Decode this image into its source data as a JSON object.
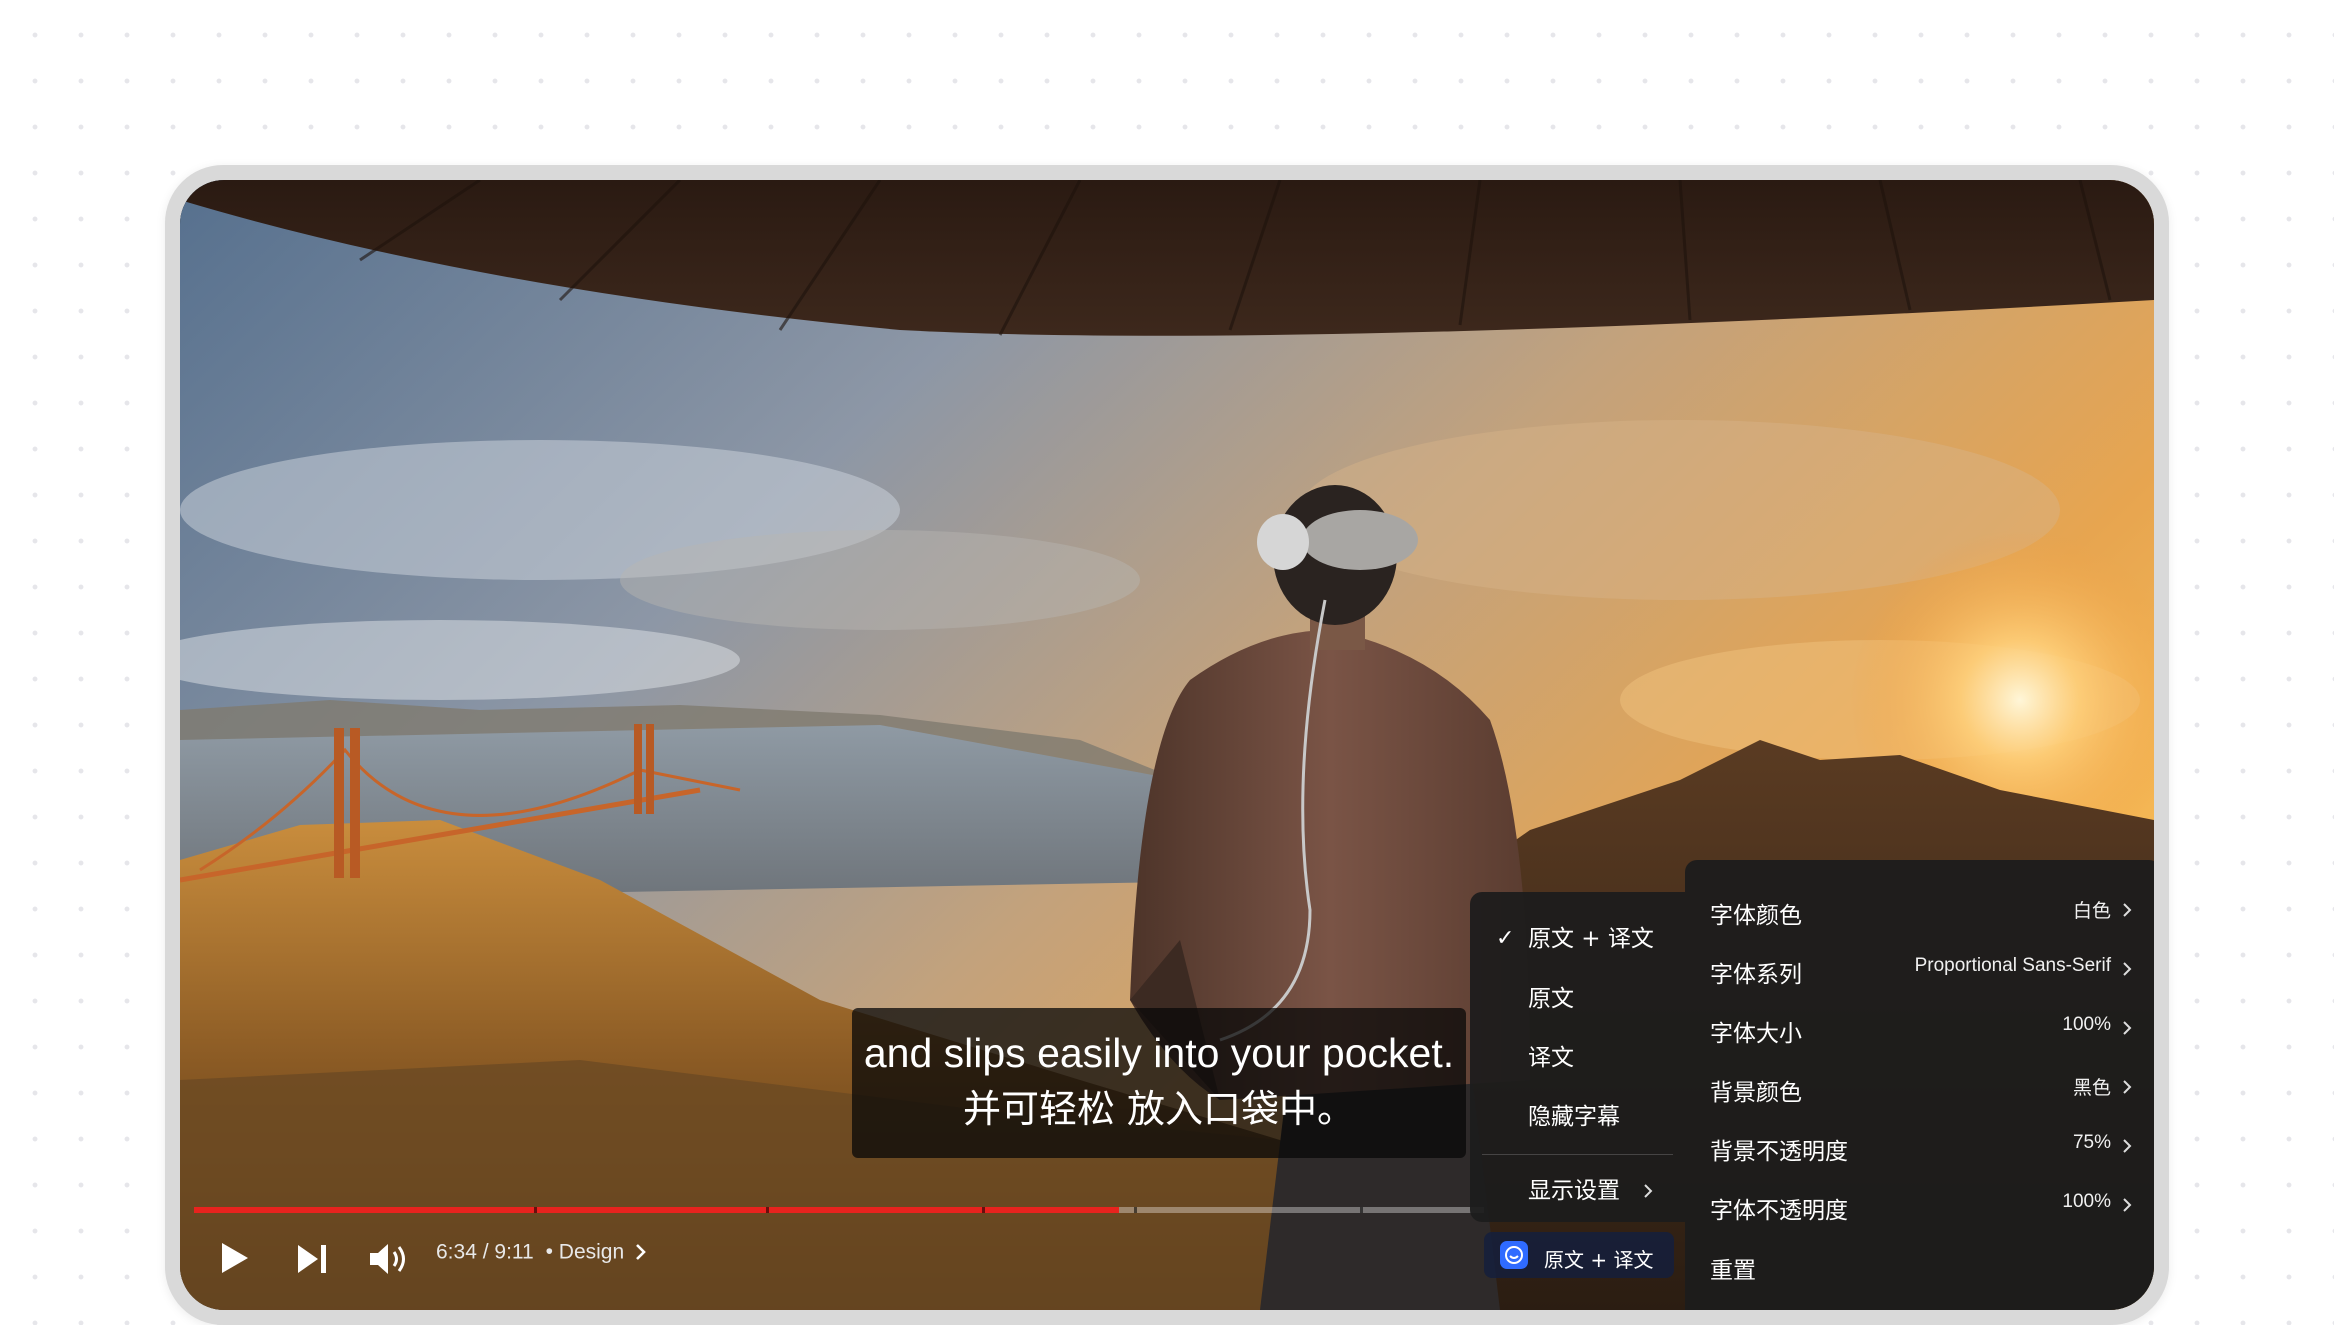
{
  "player": {
    "subtitle": {
      "original": "and slips easily into your pocket.",
      "translation": "并可轻松 放入口袋中。"
    },
    "progress": {
      "fraction": 0.717
    },
    "time": {
      "current": "6:34",
      "separator": "/",
      "duration": "9:11"
    },
    "chapter": {
      "bullet": "•",
      "label": "Design"
    },
    "controls": {
      "play_icon": "play-icon",
      "next_icon": "skip-next-icon",
      "volume_icon": "volume-icon"
    }
  },
  "caption_menu": {
    "items": [
      {
        "label": "原文 + 译文",
        "checked": true
      },
      {
        "label": "原文",
        "checked": false
      },
      {
        "label": "译文",
        "checked": false
      },
      {
        "label": "隐藏字幕",
        "checked": false
      }
    ],
    "check_mark": "✓",
    "display_settings": "显示设置"
  },
  "display_settings": {
    "items": [
      {
        "label": "字体颜色",
        "value": "白色"
      },
      {
        "label": "字体系列",
        "value": "Proportional Sans-Serif"
      },
      {
        "label": "字体大小",
        "value": "100%"
      },
      {
        "label": "背景颜色",
        "value": "黑色"
      },
      {
        "label": "背景不透明度",
        "value": "75%"
      },
      {
        "label": "字体不透明度",
        "value": "100%"
      }
    ],
    "reset": "重置"
  },
  "cc_button": {
    "label": "原文 + 译文",
    "icon": "translate-app-icon",
    "accent": "#2f6bff"
  },
  "colors": {
    "progress": "#e8231e",
    "menu_bg": "#1c1c1c"
  }
}
